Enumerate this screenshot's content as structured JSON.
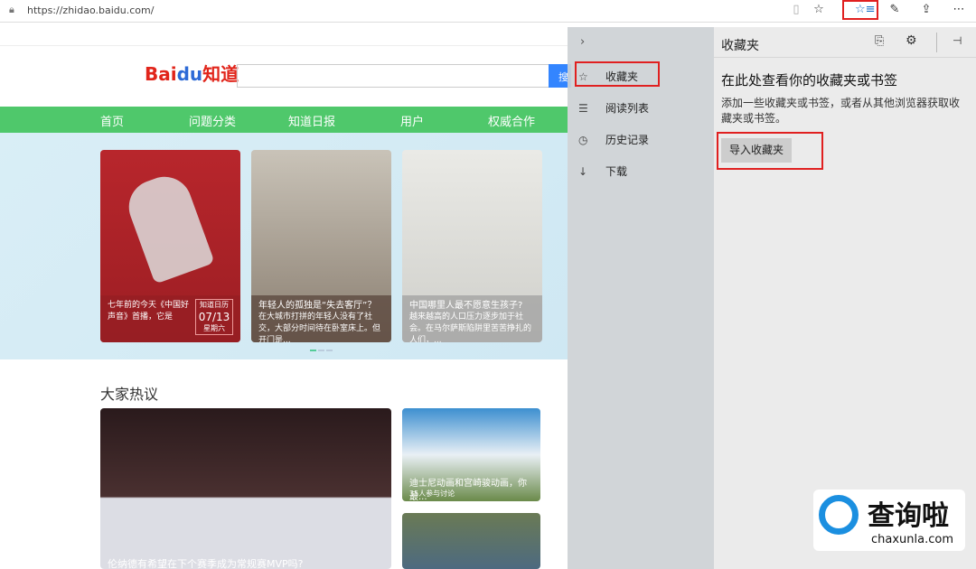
{
  "browser": {
    "url": "https://zhidao.baidu.com/"
  },
  "site": {
    "logo": "Bai du 知道",
    "logo_bai": "Bai",
    "logo_du": "du",
    "logo_zd": "知道",
    "search_button": "搜",
    "nav": [
      "首页",
      "问题分类",
      "知道日报",
      "用户",
      "权威合作"
    ],
    "cards": [
      {
        "title": "七年前的今天《中国好声音》首播，它是",
        "cal_label": "知道日历",
        "cal_date": "07/13",
        "cal_day": "星期六"
      },
      {
        "title": "年轻人的孤独是“失去客厅”？",
        "desc": "在大城市打拼的年轻人没有了社交，大部分时间待在卧室床上。但开门是..."
      },
      {
        "title": "中国哪里人最不愿意生孩子?",
        "desc": "越来越高的人口压力逐步加于社会。在马尔萨斯陷阱里苦苦挣扎的人们，..."
      }
    ],
    "hot_title": "大家热议",
    "hot": [
      {
        "title": "伦纳德有希望在下个赛季成为常规赛MVP吗?"
      },
      {
        "title": "迪士尼动画和宫崎骏动画，你最...",
        "meta": "35人参与讨论"
      }
    ]
  },
  "hub": {
    "nav": [
      {
        "icon": "star-icon",
        "label": "收藏夹"
      },
      {
        "icon": "reading-list-icon",
        "label": "阅读列表"
      },
      {
        "icon": "history-icon",
        "label": "历史记录"
      },
      {
        "icon": "download-icon",
        "label": "下载"
      }
    ],
    "title": "收藏夹",
    "heading": "在此处查看你的收藏夹或书签",
    "desc": "添加一些收藏夹或书签，或者从其他浏览器获取收藏夹或书签。",
    "import_button": "导入收藏夹"
  },
  "watermark": {
    "name": "查询啦",
    "domain": "chaxunla.com"
  }
}
